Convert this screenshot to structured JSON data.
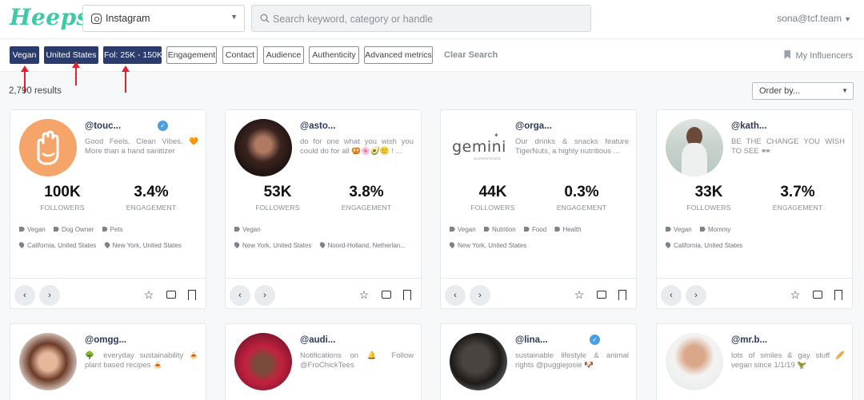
{
  "header": {
    "logo": "Heepsy",
    "platform": "Instagram",
    "search_placeholder": "Search keyword, category or handle",
    "account": "sona@tcf.team"
  },
  "filters": {
    "active": [
      "Vegan",
      "United States",
      "Fol: 25K - 150K"
    ],
    "inactive": [
      "Engagement",
      "Contact",
      "Audience",
      "Authenticity",
      "Advanced metrics"
    ],
    "clear": "Clear Search",
    "my_influencers": "My Influencers"
  },
  "results": {
    "count": "2,790 results",
    "order_by": "Order by..."
  },
  "colors": {
    "brand": "#3ec9a7",
    "active_chip": "#2b3b6b",
    "annotation_arrow": "#e3222b",
    "verified": "#4b9fe0"
  },
  "cards": [
    {
      "handle": "@touc...",
      "verified": true,
      "bio": "Good Feels. Clean Vibes. 🧡 More than a hand sanitizer",
      "followers": "100K",
      "followers_label": "FOLLOWERS",
      "engagement": "3.4%",
      "engagement_label": "ENGAGEMENT",
      "tags": [
        "Vegan",
        "Dog Owner",
        "Pets"
      ],
      "locations": [
        "California, United States",
        "New York, United States"
      ]
    },
    {
      "handle": "@asto...",
      "verified": false,
      "bio": "do for one what you wish you could do for all 🥨🌸🥑🙂 ! ...",
      "followers": "53K",
      "followers_label": "FOLLOWERS",
      "engagement": "3.8%",
      "engagement_label": "ENGAGEMENT",
      "tags": [
        "Vegan"
      ],
      "locations": [
        "New York, United States",
        "Noord-Holland, Netherlan..."
      ]
    },
    {
      "handle": "@orga...",
      "verified": false,
      "bio": "Our drinks & snacks feature TigerNuts, a highly nutritious ...",
      "followers": "44K",
      "followers_label": "FOLLOWERS",
      "engagement": "0.3%",
      "engagement_label": "ENGAGEMENT",
      "tags": [
        "Vegan",
        "Nutrition",
        "Food",
        "Health"
      ],
      "locations": [
        "New York, United States"
      ],
      "logo_text": "gemini",
      "logo_sub": "SUPERFOODS"
    },
    {
      "handle": "@kath...",
      "verified": false,
      "bio": "BE THE CHANGE YOU WISH TO SEE 🕶",
      "followers": "33K",
      "followers_label": "FOLLOWERS",
      "engagement": "3.7%",
      "engagement_label": "ENGAGEMENT",
      "tags": [
        "Vegan",
        "Mommy"
      ],
      "locations": [
        "California, United States"
      ]
    },
    {
      "handle": "@omgg...",
      "verified": false,
      "bio": "🌳 everyday sustainability 🍝 plant based recipes 🍝",
      "followers": "",
      "engagement": ""
    },
    {
      "handle": "@audi...",
      "verified": false,
      "bio": "Notifications on 🔔 Follow @FroChickTees",
      "followers": "",
      "engagement": ""
    },
    {
      "handle": "@lina...",
      "verified": true,
      "bio": "sustainable lifestyle & animal rights @puggiejosie 🐶",
      "followers": "",
      "engagement": ""
    },
    {
      "handle": "@mr.b...",
      "verified": false,
      "bio": "lots of smiles & gay stuff 🥖 vegan since 1/1/19 🦖",
      "followers": "",
      "engagement": ""
    }
  ],
  "icons": {
    "prev": "chevron-left-icon",
    "next": "chevron-right-icon",
    "favorite": "star-icon",
    "message": "comment-icon",
    "save": "bookmark-icon"
  }
}
